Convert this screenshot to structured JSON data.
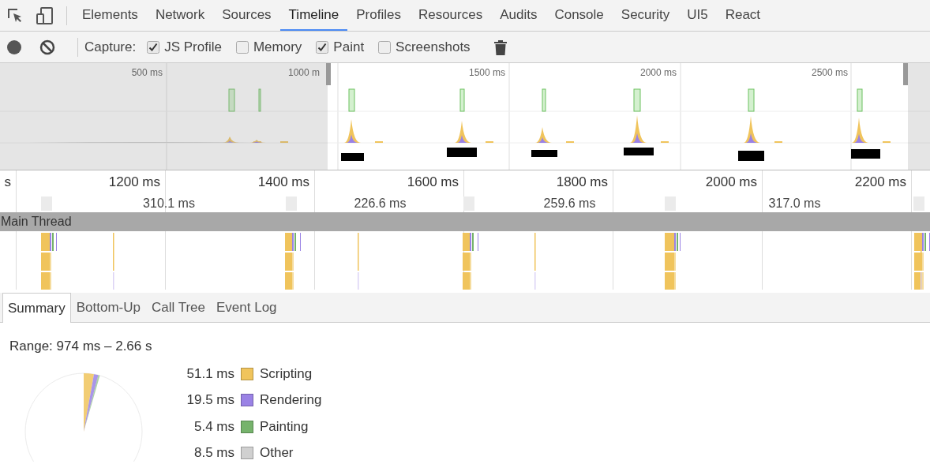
{
  "main_tabs": [
    {
      "label": "Elements",
      "selected": false
    },
    {
      "label": "Network",
      "selected": false
    },
    {
      "label": "Sources",
      "selected": false
    },
    {
      "label": "Timeline",
      "selected": true
    },
    {
      "label": "Profiles",
      "selected": false
    },
    {
      "label": "Resources",
      "selected": false
    },
    {
      "label": "Audits",
      "selected": false
    },
    {
      "label": "Console",
      "selected": false
    },
    {
      "label": "Security",
      "selected": false
    },
    {
      "label": "UI5",
      "selected": false
    },
    {
      "label": "React",
      "selected": false
    }
  ],
  "capture": {
    "label": "Capture:",
    "options": [
      {
        "label": "JS Profile",
        "checked": true
      },
      {
        "label": "Memory",
        "checked": false
      },
      {
        "label": "Paint",
        "checked": true
      },
      {
        "label": "Screenshots",
        "checked": false
      }
    ]
  },
  "overview": {
    "ticks": [
      "500 ms",
      "1000 m",
      "1500 ms",
      "2000 ms",
      "2500 ms"
    ]
  },
  "ruler": {
    "ticks": [
      "s",
      "1200 ms",
      "1400 ms",
      "1600 ms",
      "1800 ms",
      "2000 ms",
      "2200 ms"
    ],
    "frames": [
      "310.1 ms",
      "226.6 ms",
      "259.6 ms",
      "317.0 ms"
    ]
  },
  "thread": {
    "title": "Main Thread"
  },
  "detail_tabs": [
    {
      "label": "Summary",
      "selected": true
    },
    {
      "label": "Bottom-Up",
      "selected": false
    },
    {
      "label": "Call Tree",
      "selected": false
    },
    {
      "label": "Event Log",
      "selected": false
    }
  ],
  "summary": {
    "range": "Range: 974 ms – 2.66 s",
    "legend": [
      {
        "value": "51.1 ms",
        "label": "Scripting",
        "color": "#f0c45c"
      },
      {
        "value": "19.5 ms",
        "label": "Rendering",
        "color": "#9a82e5"
      },
      {
        "value": "5.4 ms",
        "label": "Painting",
        "color": "#76b36c"
      },
      {
        "value": "8.5 ms",
        "label": "Other",
        "color": "#d0d0d0"
      }
    ]
  }
}
